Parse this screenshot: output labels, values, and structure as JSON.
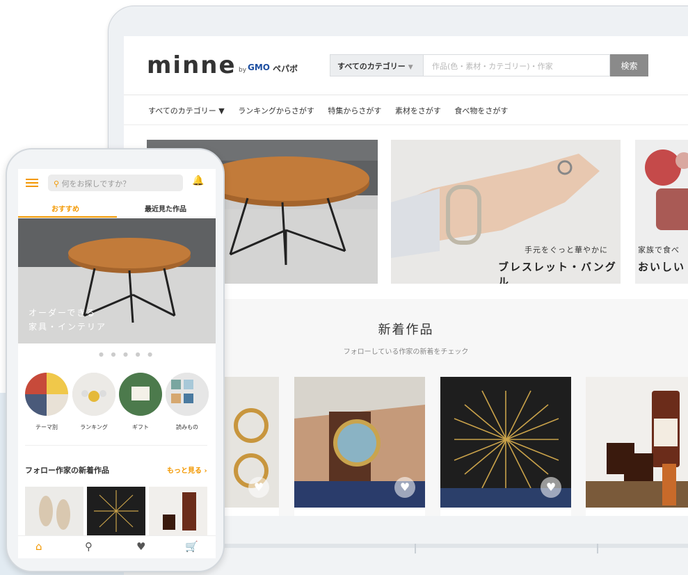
{
  "desktop": {
    "logo": {
      "main": "minne",
      "by": "by",
      "gmo": "GMO",
      "pepabo": "ペパボ"
    },
    "search": {
      "category_label": "すべてのカテゴリー",
      "category_arrow": "▼",
      "placeholder": "作品(色・素材・カテゴリー)・作家",
      "button": "検索"
    },
    "nav": [
      "すべてのカテゴリー ▼",
      "ランキングからさがす",
      "特集からさがす",
      "素材をさがす",
      "食べ物をさがす"
    ],
    "banners": [
      {
        "small": "",
        "large": ""
      },
      {
        "small": "手元をぐっと華やかに",
        "large": "ブレスレット・バングル"
      },
      {
        "small": "家族で食べ",
        "large": "おいしい"
      }
    ],
    "section": {
      "title": "新着作品",
      "subtitle": "フォローしている作家の新着をチェック"
    }
  },
  "mobile": {
    "search_placeholder": "何をお探しですか？",
    "tabs": [
      "おすすめ",
      "最近見た作品"
    ],
    "hero": {
      "line1": "オーダーできる",
      "line2": "家具・インテリア",
      "partial1": "る",
      "partial2": "リア"
    },
    "carousel_dots": "● ● ● ● ●",
    "categories": [
      "テーマ別",
      "ランキング",
      "ギフト",
      "読みもの"
    ],
    "follow": {
      "title": "フォロー作家の新着作品",
      "more": "もっと見る ›"
    }
  },
  "icons": {
    "heart": "♥",
    "search": "⚲",
    "bell": "🔔",
    "home": "⌂",
    "cart": "🛒"
  },
  "colors": {
    "accent": "#f39800",
    "text": "#333333",
    "button_gray": "#8a8a8a"
  }
}
